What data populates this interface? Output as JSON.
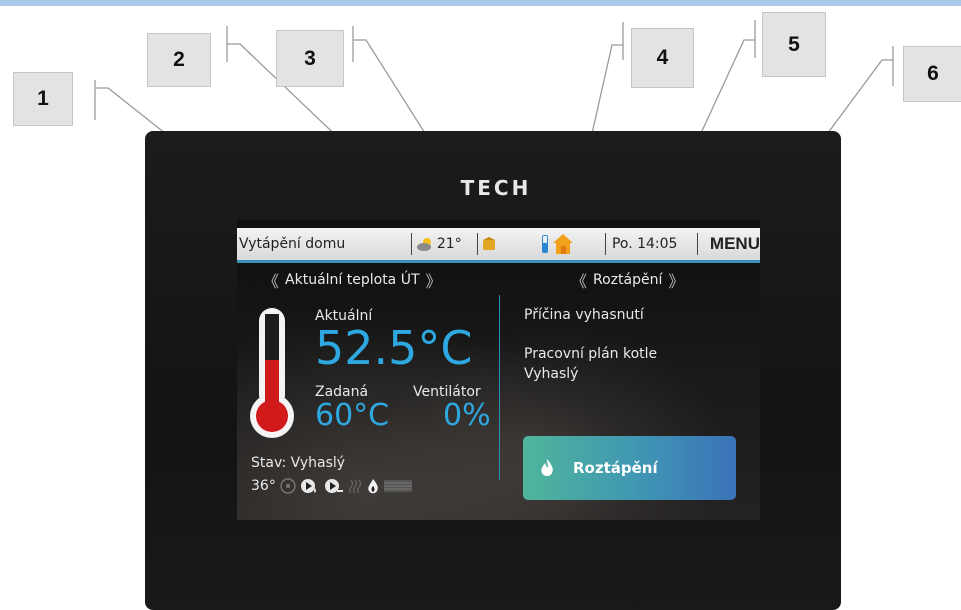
{
  "callouts": [
    "1",
    "2",
    "3",
    "4",
    "5",
    "6"
  ],
  "device": {
    "brand": "TECH"
  },
  "statusbar": {
    "title": "Vytápění domu",
    "outdoor_temp": "21°",
    "time": "Po. 14:05",
    "menu": "MENU"
  },
  "left_panel": {
    "nav_label": "Aktuální teplota ÚT",
    "current_label": "Aktuální",
    "current_value": "52.5°C",
    "set_label": "Zadaná",
    "set_value": "60°C",
    "fan_label": "Ventilátor",
    "fan_value": "0%",
    "state_text": "Stav: Vyhaslý",
    "bottom_temp": "36°"
  },
  "right_panel": {
    "nav_label": "Roztápění",
    "line1": "Příčina vyhasnutí",
    "line2": "Pracovní plán kotle",
    "line3": "Vyhaslý",
    "action_label": "Roztápění"
  },
  "colors": {
    "accent": "#2ea8e0",
    "status_underline": "#3a8fb5",
    "cta_start": "#4fb59a",
    "cta_end": "#3b72b8",
    "thermo_fill": "#d11a1a"
  }
}
